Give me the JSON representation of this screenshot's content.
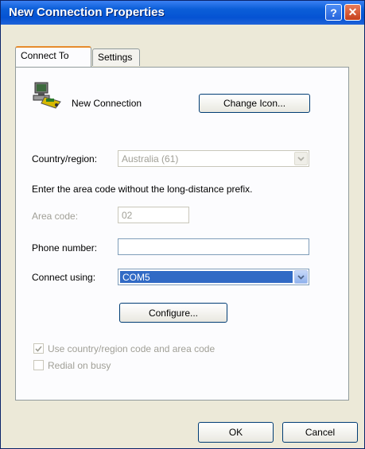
{
  "window": {
    "title": "New Connection Properties"
  },
  "tabs": [
    {
      "label": "Connect To"
    },
    {
      "label": "Settings"
    }
  ],
  "connection": {
    "name": "New Connection",
    "change_icon_label": "Change Icon..."
  },
  "country": {
    "label": "Country/region:",
    "value": "Australia (61)"
  },
  "instruction": "Enter the area code without the long-distance prefix.",
  "area_code": {
    "label": "Area code:",
    "value": "02"
  },
  "phone": {
    "label": "Phone number:",
    "value": ""
  },
  "connect_using": {
    "label": "Connect using:",
    "value": "COM5"
  },
  "configure_label": "Configure...",
  "use_country_code": {
    "label": "Use country/region code and area code",
    "checked": true
  },
  "redial": {
    "label": "Redial on busy",
    "checked": false
  },
  "footer": {
    "ok_label": "OK",
    "cancel_label": "Cancel"
  },
  "colors": {
    "title_bar": "#0553d3",
    "selection": "#316ac5",
    "window_bg": "#ece9d8"
  }
}
